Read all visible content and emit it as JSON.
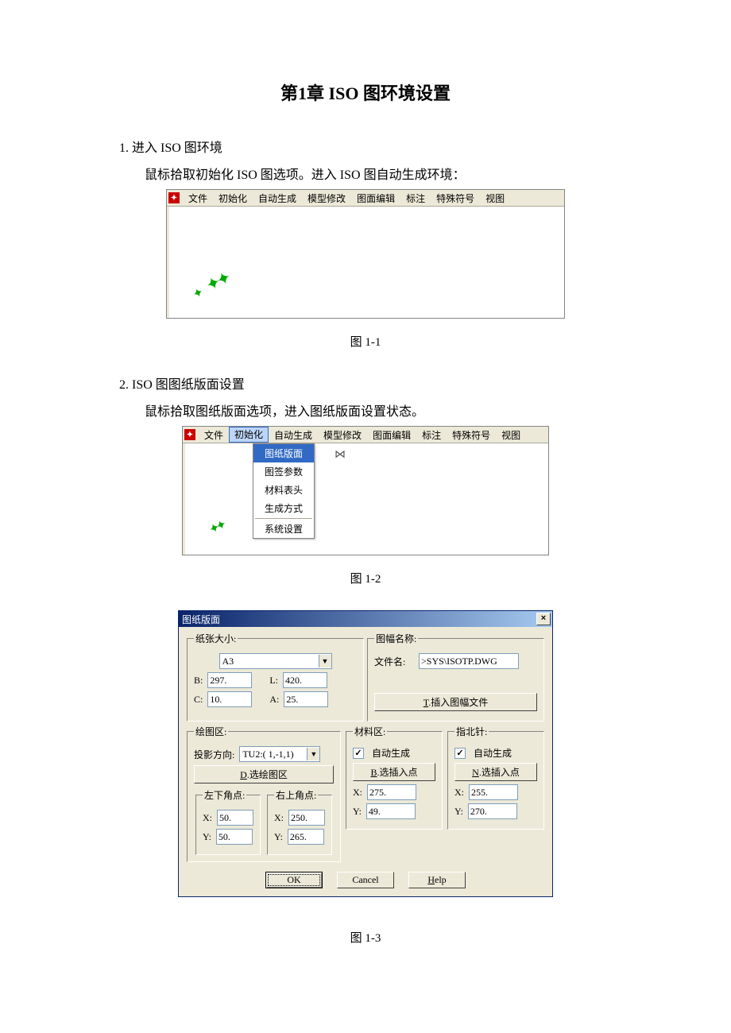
{
  "title": "第1章    ISO 图环境设置",
  "sec1": {
    "heading": "1. 进入 ISO 图环境",
    "body": "鼠标拾取初始化 ISO 图选项。进入 ISO 图自动生成环境："
  },
  "sec2": {
    "heading": "2. ISO 图图纸版面设置",
    "body": "鼠标拾取图纸版面选项，进入图纸版面设置状态。"
  },
  "caption1": "图 1-1",
  "caption2": "图 1-2",
  "caption3": "图 1-3",
  "menubar": [
    "文件",
    "初始化",
    "自动生成",
    "模型修改",
    "图面编辑",
    "标注",
    "特殊符号",
    "视图"
  ],
  "dropdown": {
    "items": [
      "图纸版面",
      "图签参数",
      "材料表头",
      "生成方式"
    ],
    "sep_after": 3,
    "last": "系统设置",
    "selected": 0
  },
  "dlg": {
    "title": "图纸版面",
    "paper": {
      "legend": "纸张大小:",
      "combo": "A3",
      "B": "B:",
      "Bval": "297.",
      "L": "L:",
      "Lval": "420.",
      "C": "C:",
      "Cval": "10.",
      "A": "A:",
      "Aval": "25."
    },
    "frame": {
      "legend": "图幅名称:",
      "flabel": "文件名:",
      "fval": ">SYS\\ISOTP.DWG",
      "btn": "T.插入图幅文件"
    },
    "draw": {
      "legend": "绘图区:",
      "projlabel": "投影方向:",
      "projval": "TU2:( 1,-1,1)",
      "btn": "D.选绘图区",
      "ll": "左下角点:",
      "ur": "右上角点:",
      "llx": "50.",
      "lly": "50.",
      "urx": "250.",
      "ury": "265."
    },
    "mat": {
      "legend": "材料区:",
      "auto": "自动生成",
      "btn": "B.选插入点",
      "x": "275.",
      "y": "49."
    },
    "north": {
      "legend": "指北针:",
      "auto": "自动生成",
      "btn": "N.选插入点",
      "x": "255.",
      "y": "270."
    },
    "xl": "X:",
    "yl": "Y:",
    "ok": "OK",
    "cancel": "Cancel",
    "help": "Help"
  }
}
